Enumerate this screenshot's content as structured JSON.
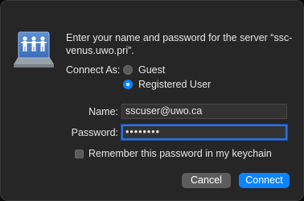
{
  "dialog": {
    "message": "Enter your name and password for the server “ssc-venus.uwo.pri”.",
    "connect_as_label": "Connect As:",
    "radio_options": [
      {
        "label": "Guest",
        "selected": false
      },
      {
        "label": "Registered User",
        "selected": true
      }
    ],
    "name_label": "Name:",
    "name_value": "sscuser@uwo.ca",
    "password_label": "Password:",
    "password_value": "••••••••",
    "remember_label": "Remember this password in my keychain",
    "remember_checked": false,
    "cancel_label": "Cancel",
    "connect_label": "Connect",
    "accent_color": "#0a84ff",
    "server_icon": "network-server-icon"
  }
}
